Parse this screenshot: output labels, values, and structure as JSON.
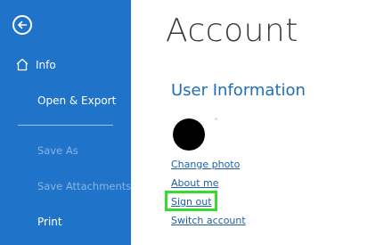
{
  "sidebar": {
    "back_icon": "arrow-left-circle-icon",
    "items": [
      {
        "label": "Info",
        "icon": "home-icon"
      },
      {
        "label": "Open & Export"
      },
      {
        "label": "Save As",
        "disabled": true
      },
      {
        "label": "Save Attachments",
        "disabled": true
      },
      {
        "label": "Print"
      }
    ]
  },
  "main": {
    "title": "Account",
    "section_title": "User Information",
    "links": {
      "change_photo": "Change photo",
      "about_me": "About me",
      "sign_out": "Sign out",
      "switch_account": "Switch account"
    }
  },
  "colors": {
    "sidebar_bg": "#1f74c9",
    "accent_text": "#1f6fb8",
    "highlight": "#33dd2a"
  }
}
